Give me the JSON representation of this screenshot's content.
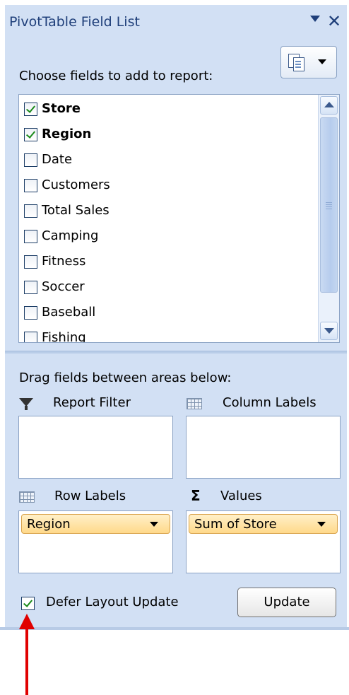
{
  "pane": {
    "title": "PivotTable Field List",
    "choose_label": "Choose fields to add to report:",
    "fields": [
      {
        "label": "Store",
        "checked": true
      },
      {
        "label": "Region",
        "checked": true
      },
      {
        "label": "Date",
        "checked": false
      },
      {
        "label": "Customers",
        "checked": false
      },
      {
        "label": "Total Sales",
        "checked": false
      },
      {
        "label": "Camping",
        "checked": false
      },
      {
        "label": "Fitness",
        "checked": false
      },
      {
        "label": "Soccer",
        "checked": false
      },
      {
        "label": "Baseball",
        "checked": false
      },
      {
        "label": "Fishing",
        "checked": false
      }
    ],
    "drag_label": "Drag fields between areas below:",
    "areas": {
      "report_filter": "Report Filter",
      "column_labels": "Column Labels",
      "row_labels": "Row Labels",
      "values": "Values"
    },
    "row_labels_items": [
      "Region"
    ],
    "values_items": [
      "Sum of Store"
    ],
    "defer_label": "Defer Layout Update",
    "defer_checked": true,
    "update_label": "Update"
  },
  "colors": {
    "pane_bg": "#d2e0f4",
    "title_text": "#1f3f7a",
    "pill_fill": "#ffd98a",
    "annotation_arrow": "#e00000"
  },
  "icons": [
    "dropdown-arrow-icon",
    "close-icon",
    "field-layout-icon",
    "filter-icon",
    "column-labels-icon",
    "row-labels-icon",
    "sigma-icon",
    "annotation-arrow"
  ]
}
